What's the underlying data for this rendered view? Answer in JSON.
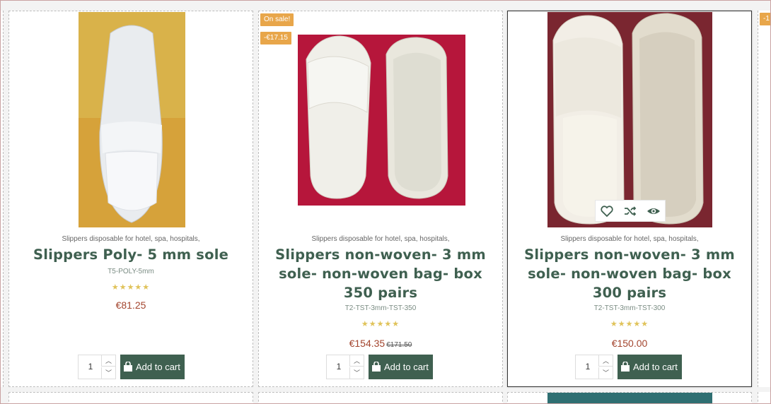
{
  "products": [
    {
      "category": "Slippers disposable for hotel, spa, hospitals,",
      "title": "Slippers Poly- 5 mm sole",
      "sku": "T5-POLY-5mm",
      "rating": "★★★★★",
      "price": "€81.25",
      "quantity": "1",
      "add_to_cart": "Add to cart"
    },
    {
      "badge_sale": "On sale!",
      "badge_discount": "-€17.15",
      "category": "Slippers disposable for hotel, spa, hospitals,",
      "title": "Slippers non-woven- 3 mm sole- non-woven bag- box 350 pairs",
      "sku": "T2-TST-3mm-TST-350",
      "rating": "★★★★★",
      "price": "€154.35",
      "old_price": "€171.50",
      "quantity": "1",
      "add_to_cart": "Add to cart"
    },
    {
      "category": "Slippers disposable for hotel, spa, hospitals,",
      "title": "Slippers non-woven- 3 mm sole- non-woven bag- box 300 pairs",
      "sku": "T2-TST-3mm-TST-300",
      "rating": "★★★★★",
      "price": "€150.00",
      "quantity": "1",
      "add_to_cart": "Add to cart"
    }
  ],
  "edge_badge": "-1",
  "icons": [
    "heart-icon",
    "shuffle-icon",
    "eye-icon",
    "cart-icon",
    "chevron-up-icon",
    "chevron-down-icon"
  ],
  "colors": {
    "accent": "#3f6050",
    "price": "#a3452e",
    "badge": "#e8a64a",
    "stars": "#e0c35a"
  }
}
